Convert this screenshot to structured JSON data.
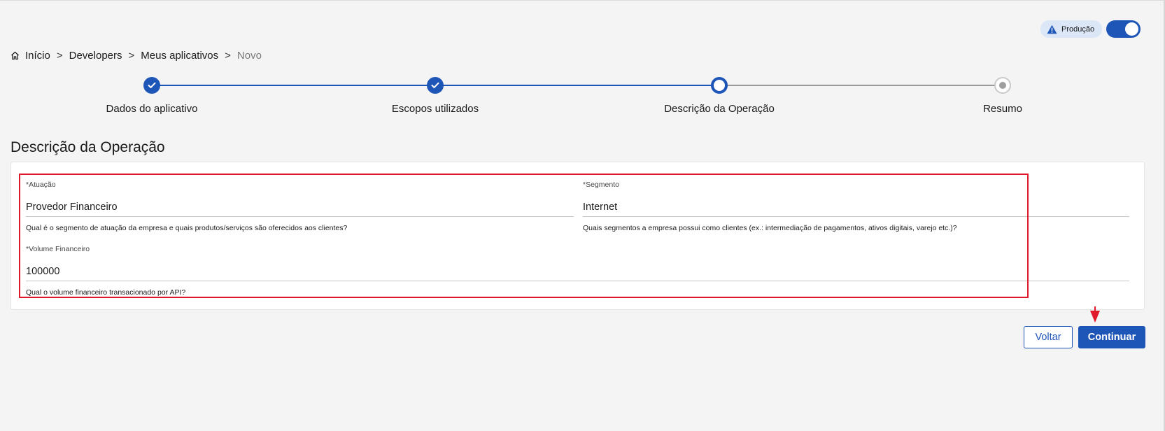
{
  "environment": {
    "badge_label": "Produção",
    "toggle_on": true
  },
  "breadcrumb": {
    "home": "Início",
    "items": [
      "Developers",
      "Meus aplicativos"
    ],
    "current": "Novo",
    "separator": ">"
  },
  "stepper": {
    "steps": [
      {
        "label": "Dados do aplicativo",
        "state": "done"
      },
      {
        "label": "Escopos utilizados",
        "state": "done"
      },
      {
        "label": "Descrição da Operação",
        "state": "current"
      },
      {
        "label": "Resumo",
        "state": "pending"
      }
    ]
  },
  "section": {
    "title": "Descrição da Operação"
  },
  "form": {
    "atuacao": {
      "label": "*Atuação",
      "value": "Provedor Financeiro",
      "help": "Qual é o segmento de atuação da empresa e quais produtos/serviços são oferecidos aos clientes?"
    },
    "segmento": {
      "label": "*Segmento",
      "value": "Internet",
      "help": "Quais segmentos a empresa possui como clientes (ex.: intermediação de pagamentos, ativos digitais, varejo etc.)?"
    },
    "volume": {
      "label": "*Volume Financeiro",
      "value": "100000",
      "help": "Qual o volume financeiro transacionado por API?"
    }
  },
  "actions": {
    "back_label": "Voltar",
    "next_label": "Continuar"
  },
  "colors": {
    "primary": "#1e56b8",
    "highlight": "#e0192b",
    "background": "#f4f4f5"
  },
  "icons": {
    "home": "home-icon",
    "warning": "warning-triangle-icon",
    "check": "check-icon",
    "annotation_arrow": "arrow-down-marker-icon"
  }
}
